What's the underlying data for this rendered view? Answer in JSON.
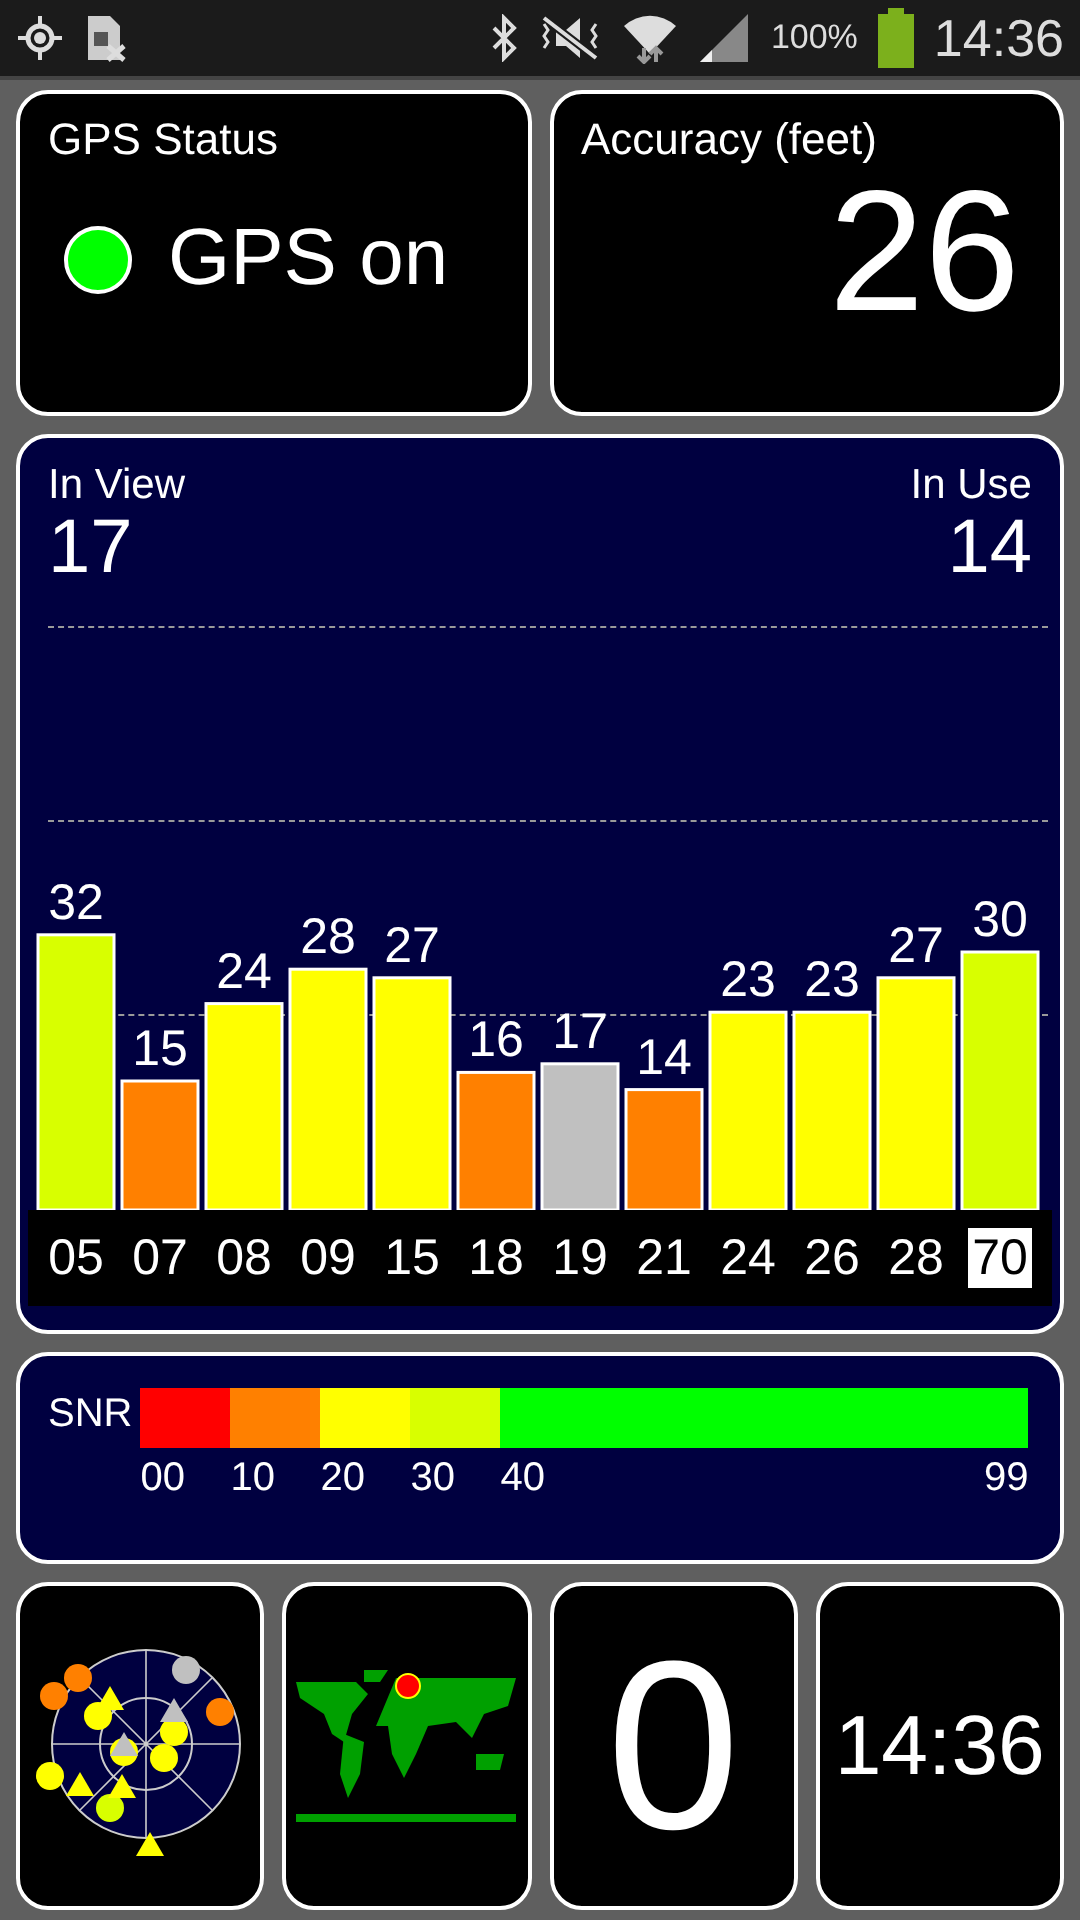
{
  "status_bar": {
    "battery_text": "100%",
    "time": "14:36"
  },
  "gps_status": {
    "title": "GPS Status",
    "on": true,
    "text": "GPS on"
  },
  "accuracy": {
    "title": "Accuracy (feet)",
    "value": "26"
  },
  "satellites_panel": {
    "in_view_label": "In View",
    "in_view": "17",
    "in_use_label": "In Use",
    "in_use": "14",
    "chart_data": {
      "type": "bar",
      "categories": [
        "05",
        "07",
        "08",
        "09",
        "15",
        "18",
        "19",
        "21",
        "24",
        "26",
        "28",
        "70"
      ],
      "data_labels": true,
      "series": [
        {
          "values": [
            32,
            15,
            24,
            28,
            27,
            16,
            17,
            14,
            23,
            23,
            27,
            30
          ]
        }
      ]
    },
    "bars": [
      {
        "used": true,
        "selected": false
      },
      {
        "used": true,
        "selected": false
      },
      {
        "used": true,
        "selected": false
      },
      {
        "used": true,
        "selected": false
      },
      {
        "used": true,
        "selected": false
      },
      {
        "used": true,
        "selected": false
      },
      {
        "used": false,
        "selected": false
      },
      {
        "used": true,
        "selected": false
      },
      {
        "used": true,
        "selected": false
      },
      {
        "used": true,
        "selected": false
      },
      {
        "used": true,
        "selected": false
      },
      {
        "used": true,
        "selected": true
      }
    ]
  },
  "snr_legend": {
    "label": "SNR",
    "segments": [
      {
        "color": "#ff0000",
        "label": "00"
      },
      {
        "color": "#ff8000",
        "label": "10"
      },
      {
        "color": "#ffff00",
        "label": "20"
      },
      {
        "color": "#d8ff00",
        "label": "30"
      },
      {
        "color": "#00ff00",
        "label": "40"
      }
    ],
    "max_label": "99"
  },
  "tiles": [
    {
      "kind": "sky_plot"
    },
    {
      "kind": "world_map"
    },
    {
      "kind": "number",
      "value": "0"
    },
    {
      "kind": "clock",
      "value": "14:36"
    }
  ]
}
